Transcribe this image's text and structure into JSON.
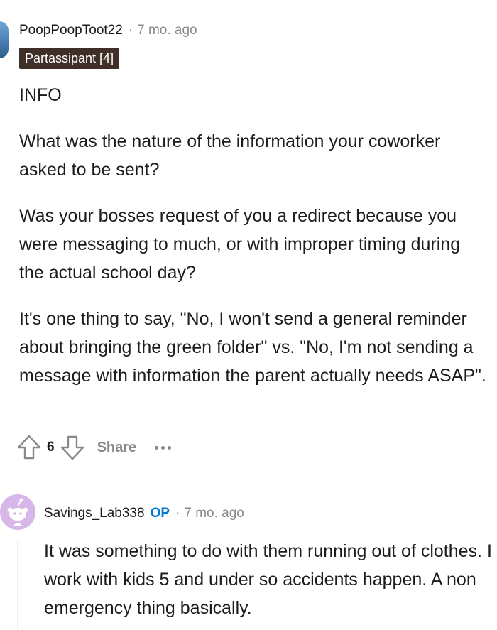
{
  "comment": {
    "username": "PoopPoopToot22",
    "separator": "·",
    "timestamp": "7 mo. ago",
    "flair": "Partassipant [4]",
    "body": [
      "INFO",
      "What was the nature of the information your coworker asked to be sent?",
      "Was your bosses request of you a redirect because you were messaging to much, or with improper timing during the actual school day?",
      "It's one thing to say, \"No, I won't send a general reminder about bringing the green folder\" vs. \"No, I'm not sending a message with information the parent actually needs ASAP\"."
    ],
    "actions": {
      "score": "6",
      "share_label": "Share",
      "upvote_icon": "arrow-up-icon",
      "downvote_icon": "arrow-down-icon",
      "more_icon": "more-dots-icon"
    }
  },
  "reply": {
    "username": "Savings_Lab338",
    "op_badge": "OP",
    "separator": "·",
    "timestamp": "7 mo. ago",
    "body": [
      "It was something to do with them running out of clothes. I work with kids 5 and under so accidents happen. A non emergency thing basically."
    ]
  },
  "colors": {
    "flair_bg": "#3f2f27",
    "op_blue": "#0079d3",
    "meta_gray": "#878a8c",
    "reply_avatar_bg": "#d7b6ea"
  }
}
